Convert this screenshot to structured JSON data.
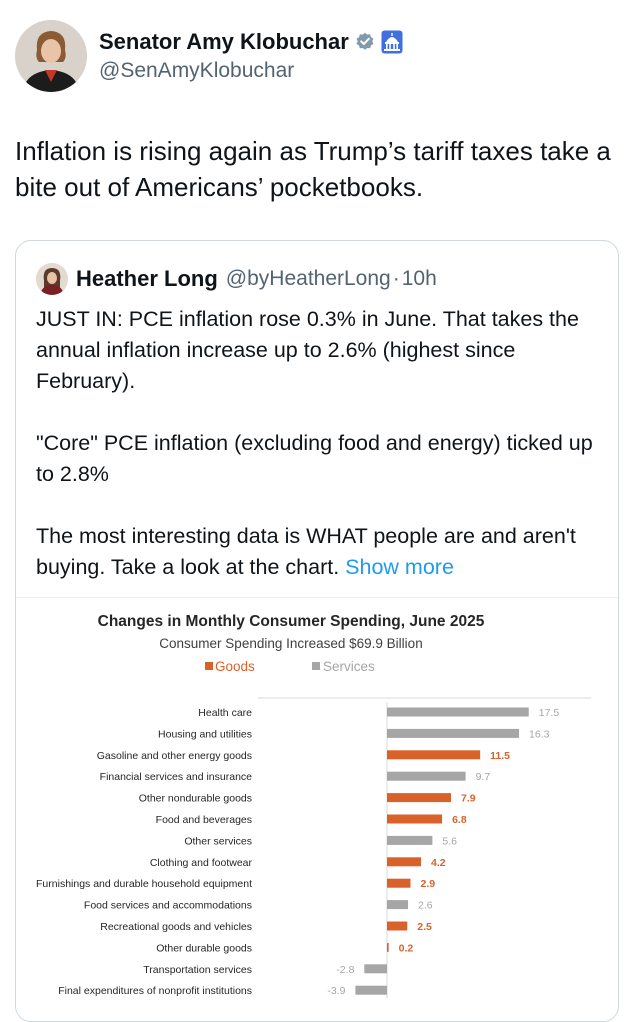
{
  "author": {
    "name": "Senator Amy Klobuchar",
    "handle": "@SenAmyKlobuchar",
    "badge_icon": "verified-gray-badge",
    "affiliation_icon": "capitol-icon"
  },
  "tweet": {
    "text": "Inflation is rising again as Trump’s tariff taxes take a bite out of Americans’ pocketbooks."
  },
  "quoted": {
    "name": "Heather Long",
    "handle": "@byHeatherLong",
    "separator": "·",
    "time": "10h",
    "paragraphs": [
      "JUST IN: PCE inflation rose 0.3% in June. That takes the annual inflation increase up to 2.6% (highest since February).",
      "\"Core\" PCE inflation (excluding food and energy) ticked up to 2.8%",
      "The most interesting data is WHAT people are and aren't buying. Take a look at the chart."
    ],
    "show_more": "Show more"
  },
  "chart_data": {
    "type": "bar",
    "orientation": "horizontal",
    "title": "Changes in Monthly Consumer Spending, June 2025",
    "subtitle": "Consumer Spending Increased $69.9 Billion",
    "legend": [
      {
        "name": "Goods",
        "color": "#d9622b"
      },
      {
        "name": "Services",
        "color": "#a6a6a6"
      }
    ],
    "legend_position": "top",
    "categories": [
      "Health care",
      "Housing and utilities",
      "Gasoline and other energy goods",
      "Financial services and insurance",
      "Other nondurable goods",
      "Food and beverages",
      "Other services",
      "Clothing and footwear",
      "Furnishings and durable household equipment",
      "Food services and accommodations",
      "Recreational goods and vehicles",
      "Other durable goods",
      "Transportation services",
      "Final expenditures of nonprofit institutions"
    ],
    "values": [
      17.5,
      16.3,
      11.5,
      9.7,
      7.9,
      6.8,
      5.6,
      4.2,
      2.9,
      2.6,
      2.5,
      0.2,
      -2.8,
      -3.9
    ],
    "types": [
      "Services",
      "Services",
      "Goods",
      "Services",
      "Goods",
      "Goods",
      "Services",
      "Goods",
      "Goods",
      "Services",
      "Goods",
      "Goods",
      "Services",
      "Services"
    ],
    "value_labels": [
      "17.5",
      "16.3",
      "11.5",
      "9.7",
      "7.9",
      "6.8",
      "5.6",
      "4.2",
      "2.9",
      "2.6",
      "2.5",
      "0.2",
      "-2.8",
      "-3.9"
    ],
    "xlim": [
      -4,
      20
    ],
    "grid": false
  }
}
